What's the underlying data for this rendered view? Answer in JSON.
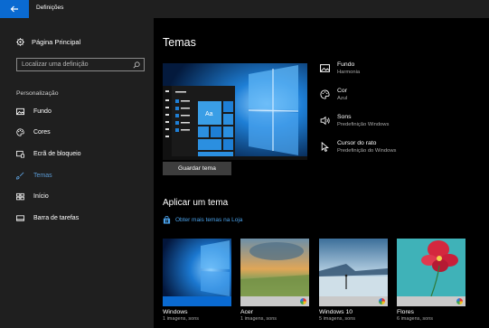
{
  "window": {
    "title": "Definições"
  },
  "sidebar": {
    "home_label": "Página Principal",
    "search_placeholder": "Localizar uma definição",
    "section_label": "Personalização",
    "items": [
      {
        "label": "Fundo",
        "icon": "picture-icon"
      },
      {
        "label": "Cores",
        "icon": "palette-icon"
      },
      {
        "label": "Ecrã de bloqueio",
        "icon": "lock-screen-icon"
      },
      {
        "label": "Temas",
        "icon": "brush-icon",
        "active": true
      },
      {
        "label": "Início",
        "icon": "start-icon"
      },
      {
        "label": "Barra de tarefas",
        "icon": "taskbar-icon"
      }
    ]
  },
  "main": {
    "title": "Temas",
    "properties": [
      {
        "name": "Fundo",
        "value": "Harmonia",
        "icon": "picture-icon"
      },
      {
        "name": "Cor",
        "value": "Azul",
        "icon": "palette-icon"
      },
      {
        "name": "Sons",
        "value": "Predefinição Windows",
        "icon": "speaker-icon"
      },
      {
        "name": "Cursor do rato",
        "value": "Predefinição do Windows",
        "icon": "cursor-icon"
      }
    ],
    "save_button": "Guardar tema",
    "apply_title": "Aplicar um tema",
    "store_link": "Obter mais temas na Loja",
    "preview_tile_label": "Aa",
    "accent_color": "#0078d7",
    "themes": [
      {
        "name": "Windows",
        "count": "1 imagens, sons",
        "strip_color": "#0a6ad1"
      },
      {
        "name": "Acer",
        "count": "1 imagens, sons",
        "strip_color": "#c9c9c9"
      },
      {
        "name": "Windows 10",
        "count": "5 imagens, sons",
        "strip_color": "#c9c9c9"
      },
      {
        "name": "Flores",
        "count": "6 imagens, sons",
        "strip_color": "#c9c9c9"
      }
    ]
  }
}
